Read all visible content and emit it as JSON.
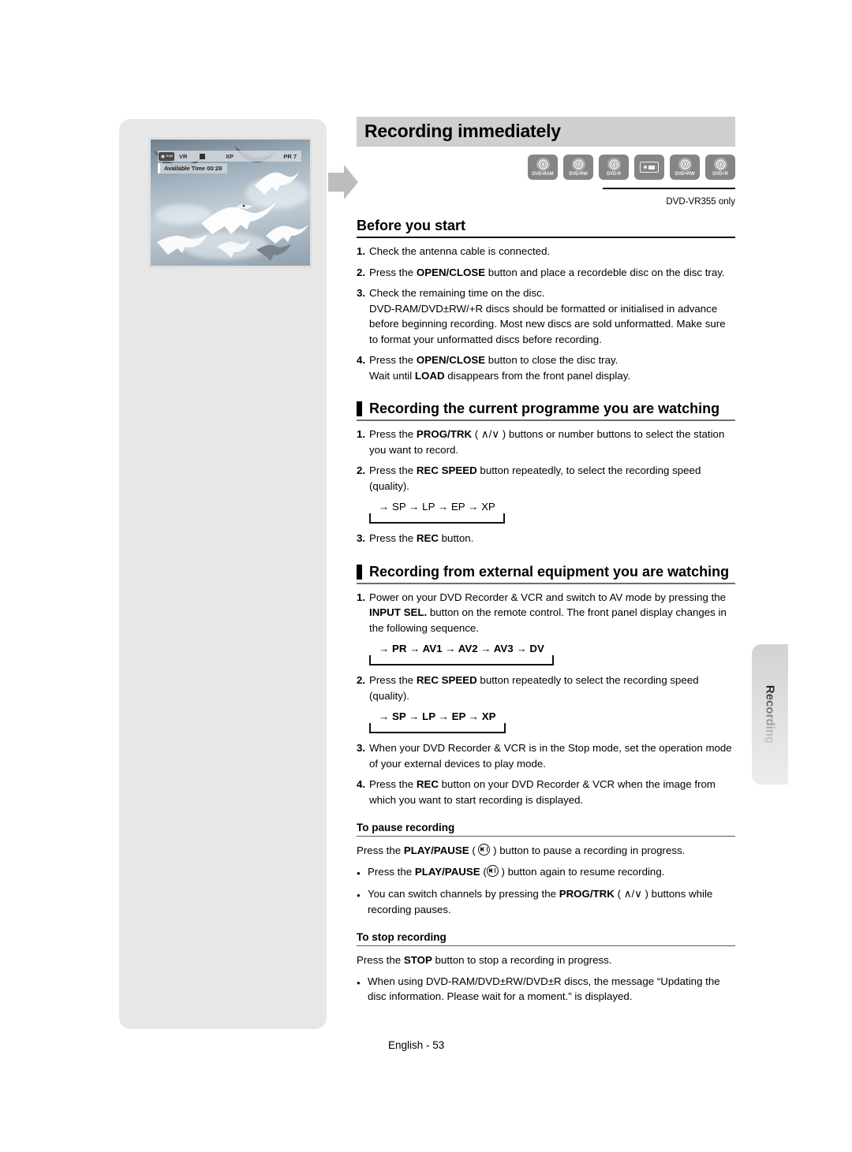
{
  "page": {
    "title": "Recording immediately",
    "footer": "English - 53",
    "side_tab": "Recording"
  },
  "disc_badges": {
    "items": [
      {
        "label": "DVD-RAM",
        "icon": "disc-icon"
      },
      {
        "label": "DVD-RW",
        "icon": "disc-icon"
      },
      {
        "label": "DVD-R",
        "icon": "disc-icon"
      },
      {
        "label": "",
        "icon": "vhs-cassette-icon"
      },
      {
        "label": "DVD+RW",
        "icon": "disc-icon"
      },
      {
        "label": "DVD+R",
        "icon": "disc-icon"
      }
    ],
    "note": "DVD-VR355 only"
  },
  "tv_figure": {
    "osd": {
      "disc_label": "RAM",
      "mode": "VR",
      "status_icon": "stop-square-icon",
      "speed": "XP",
      "channel": "PR 7",
      "available_time": "Available Time 00:28"
    }
  },
  "before_you_start": {
    "heading": "Before you start",
    "steps": [
      {
        "num": "1.",
        "html": "Check the antenna cable is connected."
      },
      {
        "num": "2.",
        "html": "Press the <b>OPEN/CLOSE</b> button and place a recordeble disc on the disc tray."
      },
      {
        "num": "3.",
        "html": "Check the remaining time on the disc.<br>DVD-RAM/DVD±RW/+R discs should be formatted or initialised in advance before beginning recording. Most new discs are sold unformatted. Make sure to format your unformatted discs before recording."
      },
      {
        "num": "4.",
        "html": "Press the <b>OPEN/CLOSE</b> button to close the disc tray.<br>Wait until <b>LOAD</b> disappears from the front panel display."
      }
    ]
  },
  "current_programme": {
    "heading": "Recording the current programme you are watching",
    "steps": [
      {
        "num": "1.",
        "html": "Press the <b>PROG/TRK</b> ( ∧/∨ ) buttons or number buttons to select the station you want to record."
      },
      {
        "num": "2.",
        "html": "Press the <b>REC SPEED</b> button repeatedly, to select the recording speed (quality)."
      }
    ],
    "sequence": "→ SP → LP → EP → XP",
    "final_step": {
      "num": "3.",
      "html": "Press the <b>REC</b> button."
    }
  },
  "external_equipment": {
    "heading": "Recording from external equipment you are watching",
    "step1": {
      "num": "1.",
      "html": "Power on your DVD Recorder &amp; VCR and switch to AV mode by pressing the <b>INPUT SEL.</b> button on the remote control. The front panel display changes in the following sequence."
    },
    "sequence1": "→ PR → AV1 → AV2 → AV3 → DV",
    "step2": {
      "num": "2.",
      "html": "Press the <b>REC SPEED</b> button repeatedly to select the recording speed (quality)."
    },
    "sequence2": "→ SP → LP → EP → XP",
    "step3": {
      "num": "3.",
      "html": "When your DVD Recorder &amp; VCR is in the Stop mode, set the operation mode of your external devices to play mode."
    },
    "step4": {
      "num": "4.",
      "html": "Press the <b>REC</b> button on your DVD Recorder &amp; VCR when the image from which you want to start recording is displayed."
    }
  },
  "to_pause_recording": {
    "heading": "To pause recording",
    "lead_before": "Press the ",
    "lead_bold": "PLAY/PAUSE",
    "lead_after": " ) button to pause a recording in progress.",
    "bullets": [
      {
        "before": "Press the ",
        "bold": "PLAY/PAUSE",
        "after": " ) button again to resume recording.",
        "has_icon": true
      },
      {
        "html": "You can switch channels by pressing the <b>PROG/TRK</b> ( ∧/∨ ) buttons while recording pauses.",
        "has_icon": false
      }
    ]
  },
  "to_stop_recording": {
    "heading": "To stop recording",
    "lead": "Press the <b>STOP</b> button to stop a recording in progress.",
    "bullets": [
      {
        "html": "When using DVD-RAM/DVD±RW/DVD±R discs, the message “Updating the disc information. Please wait for a moment.” is displayed."
      }
    ]
  }
}
